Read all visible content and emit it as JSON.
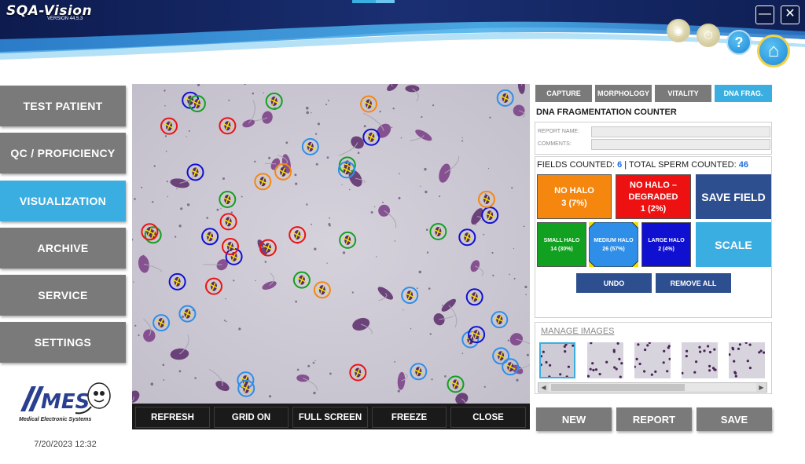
{
  "app": {
    "brand": "SQA-Vision",
    "version": "VERSION 44.5.3"
  },
  "window_controls": {
    "minimize": "—",
    "close": "✕"
  },
  "header_icons": [
    {
      "name": "eye-icon",
      "glyph": "◉"
    },
    {
      "name": "timer-icon",
      "glyph": "⏱"
    },
    {
      "name": "help-icon",
      "glyph": "?"
    },
    {
      "name": "home-icon",
      "glyph": "⌂"
    }
  ],
  "sidebar": {
    "items": [
      {
        "label": "TEST PATIENT",
        "active": false
      },
      {
        "label": "QC / PROFICIENCY",
        "active": false
      },
      {
        "label": "VISUALIZATION",
        "active": true
      },
      {
        "label": "ARCHIVE",
        "active": false
      },
      {
        "label": "SERVICE",
        "active": false
      },
      {
        "label": "SETTINGS",
        "active": false
      }
    ],
    "logo_text": "MES",
    "logo_caption": "Medical Electronic Systems",
    "datetime": "7/20/2023 12:32"
  },
  "microscope": {
    "controls": [
      {
        "label": "REFRESH",
        "color": "#7a7a7a"
      },
      {
        "label": "GRID ON",
        "color": "#2e4f8f"
      },
      {
        "label": "FULL SCREEN",
        "color": "#2e4f8f"
      },
      {
        "label": "FREEZE",
        "color": "#7a7a7a"
      },
      {
        "label": "CLOSE",
        "color": "#ee1111"
      }
    ]
  },
  "tabs": [
    {
      "label": "CAPTURE",
      "active": false
    },
    {
      "label": "MORPHOLOGY",
      "active": false
    },
    {
      "label": "VITALITY",
      "active": false
    },
    {
      "label": "DNA FRAG.",
      "active": true
    }
  ],
  "panel": {
    "title": "DNA FRAGMENTATION COUNTER",
    "report_name_label": "REPORT NAME:",
    "report_name_value": "",
    "comments_label": "COMMENTS:",
    "comments_value": "",
    "fields_counted_label": "FIELDS COUNTED:",
    "fields_counted_value": "6",
    "total_sperm_label": "| TOTAL SPERM COUNTED:",
    "total_sperm_value": "46",
    "counters": {
      "no_halo": {
        "label": "NO HALO",
        "value": "3 (7%)",
        "color": "#f5870f"
      },
      "no_halo_degraded": {
        "label": "NO HALO –",
        "label2": "DEGRADED",
        "value": "1 (2%)",
        "color": "#ee1111"
      },
      "small_halo": {
        "label": "SMALL HALO",
        "value": "14 (30%)",
        "color": "#11a020"
      },
      "medium_halo": {
        "label": "MEDIUM HALO",
        "value": "26 (57%)",
        "color": "#2e8ee8"
      },
      "large_halo": {
        "label": "LARGE HALO",
        "value": "2 (4%)",
        "color": "#1010d0"
      }
    },
    "save_field": "SAVE FIELD",
    "scale": "SCALE",
    "undo": "UNDO",
    "remove_all": "REMOVE ALL",
    "manage_images": "MANAGE IMAGES",
    "scroll_left": "◀",
    "scroll_right": "▶"
  },
  "bottom_buttons": {
    "new": "NEW",
    "report": "REPORT",
    "save": "SAVE"
  },
  "colors": {
    "accent_blue": "#3aaee0",
    "button_gray": "#7a7a7a",
    "dark_blue": "#2e4f8f",
    "header_navy": "#13255e"
  }
}
